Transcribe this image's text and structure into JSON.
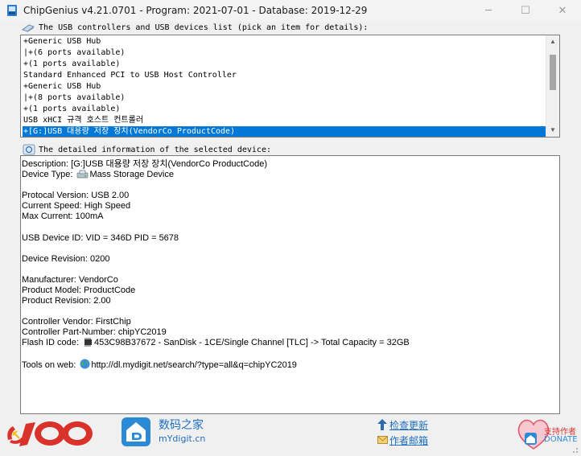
{
  "window": {
    "title": "ChipGenius v4.21.0701 - Program: 2021-07-01 - Database: 2019-12-29",
    "minimize_glyph": "─",
    "maximize_glyph": "☐",
    "close_glyph": "✕"
  },
  "devices_section": {
    "label": "The USB controllers and USB devices list (pick an item for details):",
    "items": [
      "+Generic USB Hub",
      "|+(6 ports available)",
      "+(1 ports available)",
      "Standard Enhanced PCI to USB Host Controller",
      "+Generic USB Hub",
      "|+(8 ports available)",
      "+(1 ports available)",
      "USB xHCI 규격 호스트 컨트롤러",
      "+[G:]USB 대용량 저장 장치(VendorCo ProductCode)"
    ],
    "selected_index": 8
  },
  "details_section": {
    "label": "The detailed information of the selected device:",
    "description": "Description: [G:]USB 대용량 저장 장치(VendorCo ProductCode)",
    "device_type_label": "Device Type:",
    "device_type_value": "Mass Storage Device",
    "protocol_version": "Protocal Version: USB 2.00",
    "current_speed": "Current Speed: High Speed",
    "max_current": "Max Current: 100mA",
    "usb_device_id": "USB Device ID: VID = 346D PID = 5678",
    "device_revision": "Device Revision: 0200",
    "manufacturer": "Manufacturer: VendorCo",
    "product_model": "Product Model: ProductCode",
    "product_revision": "Product Revision: 2.00",
    "controller_vendor": "Controller Vendor: FirstChip",
    "controller_part_number": "Controller Part-Number: chipYC2019",
    "flash_id_label": "Flash ID code:",
    "flash_id_value": "453C98B37672 - SanDisk - 1CE/Single Channel [TLC] -> Total Capacity = 32GB",
    "tools_label": "Tools on web:",
    "tools_url": "http://dl.mydigit.net/search/?type=all&q=chipYC2019"
  },
  "footer": {
    "site_name": "数码之家",
    "site_url": "mYdigit.cn",
    "check_update": "检查更新",
    "author_email": "作者邮箱",
    "donate_cn": "支持作者",
    "donate_en": "DONATE"
  },
  "colors": {
    "selection": "#0078d7",
    "link": "#1e6fbf",
    "donate_red": "#e0342f"
  }
}
